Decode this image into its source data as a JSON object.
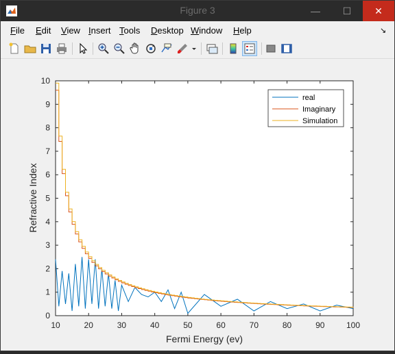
{
  "window": {
    "title": "Figure 3",
    "minimize_glyph": "—",
    "maximize_glyph": "☐",
    "close_glyph": "✕"
  },
  "menubar": {
    "items": [
      {
        "label": "File",
        "key": "F",
        "rest": "ile"
      },
      {
        "label": "Edit",
        "key": "E",
        "rest": "dit"
      },
      {
        "label": "View",
        "key": "V",
        "rest": "iew"
      },
      {
        "label": "Insert",
        "key": "I",
        "rest": "nsert"
      },
      {
        "label": "Tools",
        "key": "T",
        "rest": "ools"
      },
      {
        "label": "Desktop",
        "key": "D",
        "rest": "esktop"
      },
      {
        "label": "Window",
        "key": "W",
        "rest": "indow"
      },
      {
        "label": "Help",
        "key": "H",
        "rest": "elp"
      }
    ],
    "dock_glyph": "↘"
  },
  "toolbar": {
    "icons": [
      "new-figure-icon",
      "open-file-icon",
      "save-icon",
      "print-icon",
      "pointer-icon",
      "zoom-in-icon",
      "zoom-out-icon",
      "pan-hand-icon",
      "rotate-3d-icon",
      "data-cursor-icon",
      "brush-icon",
      "brush-dropdown-icon",
      "link-plot-icon",
      "colorbar-icon",
      "legend-icon",
      "hide-plot-tools-icon",
      "show-plot-tools-icon"
    ]
  },
  "chart_data": {
    "type": "line",
    "xlabel": "Fermi Energy (ev)",
    "ylabel": "Refractive Index",
    "xlim": [
      10,
      100
    ],
    "ylim": [
      0,
      10
    ],
    "xticks": [
      10,
      20,
      30,
      40,
      50,
      60,
      70,
      80,
      90,
      100
    ],
    "yticks": [
      0,
      1,
      2,
      3,
      4,
      5,
      6,
      7,
      8,
      9,
      10
    ],
    "grid": false,
    "legend_position": "top-right",
    "series": [
      {
        "name": "real",
        "color": "#0072bd",
        "description_points": {
          "x": [
            10,
            11,
            12,
            13,
            14,
            15,
            16,
            17,
            18,
            19,
            20,
            21,
            22,
            23,
            24,
            25,
            26,
            27,
            28,
            29,
            30,
            32,
            34,
            36,
            38,
            40,
            42,
            44,
            46,
            48,
            50,
            55,
            60,
            65,
            70,
            75,
            80,
            85,
            90,
            95,
            100
          ],
          "y": [
            2.4,
            0.4,
            1.9,
            0.5,
            1.8,
            0.2,
            2.2,
            0.4,
            2.5,
            0.3,
            2.4,
            0.5,
            2.4,
            0.3,
            2.0,
            0.4,
            1.8,
            0.3,
            1.5,
            0.2,
            1.3,
            0.6,
            1.2,
            0.9,
            0.8,
            1.0,
            0.6,
            1.1,
            0.3,
            1.0,
            0.1,
            0.9,
            0.4,
            0.7,
            0.2,
            0.6,
            0.3,
            0.5,
            0.2,
            0.45,
            0.3
          ]
        }
      },
      {
        "name": "Imaginary",
        "color": "#d95319",
        "curve": {
          "x0": 10,
          "y0": 9.6,
          "x1": 100,
          "y1": 0.35
        }
      },
      {
        "name": "Simulation",
        "color": "#edb120",
        "curve": {
          "x0": 10,
          "y0": 9.9,
          "x1": 100,
          "y1": 0.36
        }
      }
    ]
  }
}
